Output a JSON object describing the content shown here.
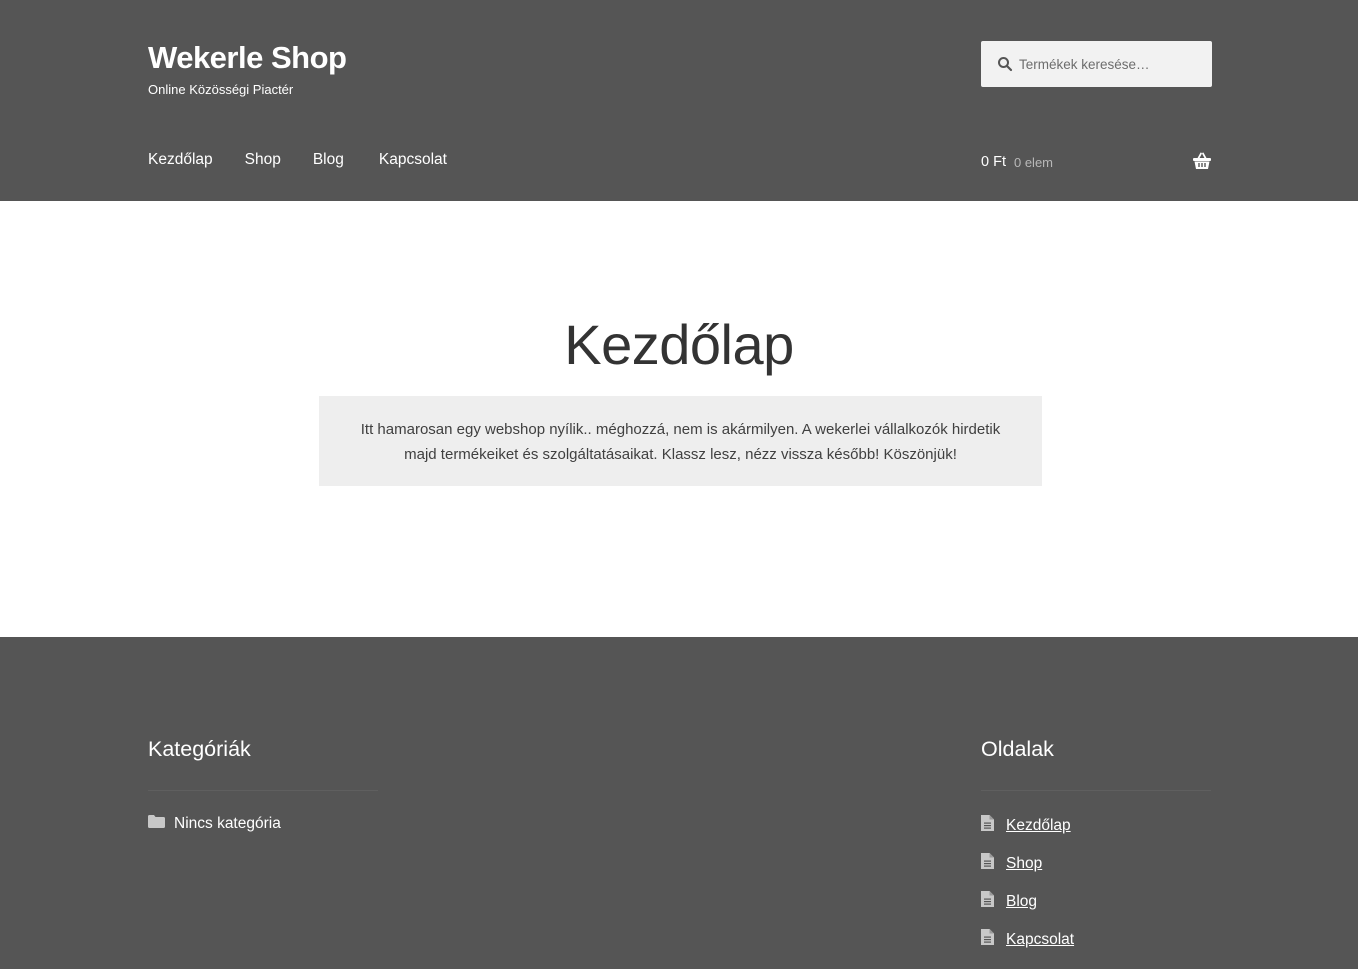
{
  "site": {
    "title": "Wekerle Shop",
    "tagline": "Online Közösségi Piactér"
  },
  "search": {
    "placeholder": "Termékek keresése…",
    "value": ""
  },
  "nav": {
    "items": [
      {
        "label": "Kezdőlap"
      },
      {
        "label": "Shop"
      },
      {
        "label": "Blog"
      },
      {
        "label": "Kapcsolat"
      }
    ]
  },
  "cart": {
    "amount": "0 Ft",
    "count": "0 elem"
  },
  "main": {
    "title": "Kezdőlap",
    "notice": "Itt hamarosan egy webshop nyílik.. méghozzá, nem is akármilyen. A wekerlei vállalkozók hirdetik majd termékeiket és szolgáltatásaikat. Klassz lesz, nézz vissza később! Köszönjük!"
  },
  "footer": {
    "categories": {
      "title": "Kategóriák",
      "items": [
        {
          "label": "Nincs kategória"
        }
      ]
    },
    "pages": {
      "title": "Oldalak",
      "items": [
        {
          "label": "Kezdőlap"
        },
        {
          "label": "Shop"
        },
        {
          "label": "Blog"
        },
        {
          "label": "Kapcsolat"
        }
      ]
    }
  },
  "colors": {
    "header_bg": "#555555",
    "footer_bg": "#555555",
    "notice_bg": "#eeeeee",
    "text_light": "#ffffff"
  },
  "icons": {
    "search": "search-icon",
    "cart": "basket-icon",
    "category": "folder-icon",
    "page": "document-icon"
  }
}
